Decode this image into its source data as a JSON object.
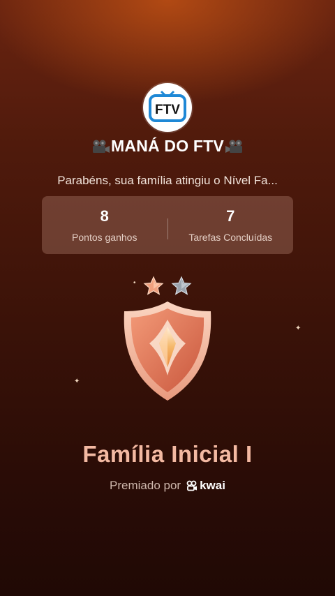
{
  "family": {
    "logo_text": "FTV",
    "name": "MANÁ DO FTV",
    "message": "Parabéns, sua família atingiu o Nível Fa..."
  },
  "stats": [
    {
      "value": "8",
      "label": "Pontos ganhos"
    },
    {
      "value": "7",
      "label": "Tarefas Concluídas"
    }
  ],
  "badge": {
    "stars_earned": 1,
    "stars_total": 2,
    "level_name": "Família Inicial I"
  },
  "footer": {
    "awarded_by": "Premiado por",
    "brand": "kwai"
  },
  "colors": {
    "accent": "#f3b9a2",
    "logo_blue": "#1e88d6",
    "bronze": "#e8866a"
  },
  "icons": [
    "movie-camera-icon",
    "movie-camera-icon",
    "bronze-star-icon",
    "silver-star-icon",
    "shield-badge-icon",
    "kwai-logo-icon"
  ]
}
